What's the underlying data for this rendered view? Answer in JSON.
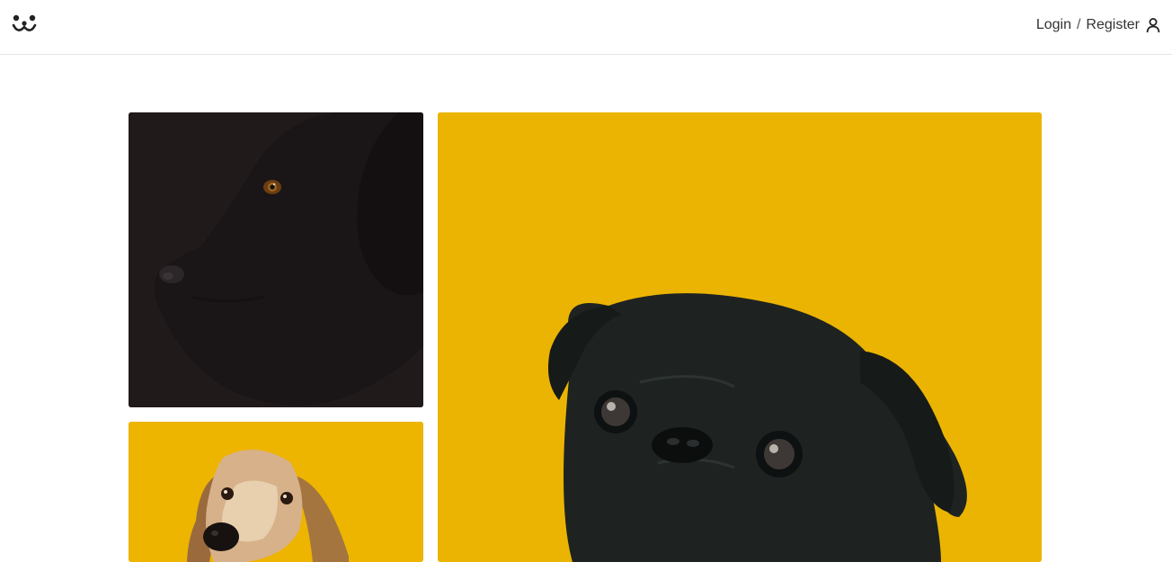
{
  "header": {
    "logo_icon": "smiling-dog-face-icon",
    "login_label": "Login",
    "separator": "/",
    "register_label": "Register",
    "user_icon": "user-icon"
  },
  "gallery": {
    "images": [
      {
        "subject": "black-dog-portrait",
        "background": "#211a1b"
      },
      {
        "subject": "black-pug-portrait",
        "background": "#ebb402"
      },
      {
        "subject": "saluki-portrait",
        "background": "#edb400"
      }
    ]
  }
}
